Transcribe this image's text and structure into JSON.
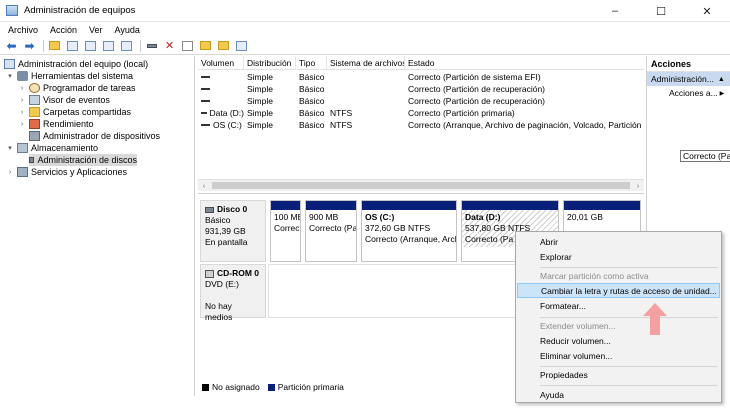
{
  "window": {
    "title": "Administración de equipos",
    "minimize_glyph": "–",
    "maximize_glyph": "☐",
    "close_glyph": "✕"
  },
  "menu": [
    "Archivo",
    "Acción",
    "Ver",
    "Ayuda"
  ],
  "toolbar": {
    "icons": [
      "back-arrow-icon",
      "forward-arrow-icon",
      "up-folder-icon",
      "show-tree-icon",
      "properties-icon",
      "help-icon",
      "connect-icon",
      "delete-icon",
      "check-icon",
      "folder-icon",
      "rescan-icon",
      "view-icon"
    ]
  },
  "tree": {
    "items": [
      {
        "label": "Administración del equipo (local)",
        "level": 0,
        "expanded": "",
        "icon": "computer-icon"
      },
      {
        "label": "Herramientas del sistema",
        "level": 1,
        "expanded": "▾",
        "icon": "tools-icon"
      },
      {
        "label": "Programador de tareas",
        "level": 2,
        "expanded": "›",
        "icon": "clock-icon"
      },
      {
        "label": "Visor de eventos",
        "level": 2,
        "expanded": "›",
        "icon": "event-log-icon"
      },
      {
        "label": "Carpetas compartidas",
        "level": 2,
        "expanded": "›",
        "icon": "shared-folder-icon"
      },
      {
        "label": "Rendimiento",
        "level": 2,
        "expanded": "›",
        "icon": "performance-icon"
      },
      {
        "label": "Administrador de dispositivos",
        "level": 2,
        "expanded": "",
        "icon": "device-manager-icon"
      },
      {
        "label": "Almacenamiento",
        "level": 1,
        "expanded": "▾",
        "icon": "storage-icon"
      },
      {
        "label": "Administración de discos",
        "level": 2,
        "expanded": "",
        "icon": "disk-icon",
        "selected": true
      },
      {
        "label": "Servicios y Aplicaciones",
        "level": 1,
        "expanded": "›",
        "icon": "services-icon"
      }
    ]
  },
  "volumes": {
    "columns": [
      "Volumen",
      "Distribución",
      "Tipo",
      "Sistema de archivos",
      "Estado"
    ],
    "rows": [
      {
        "volume": "",
        "layout": "Simple",
        "type": "Básico",
        "fs": "",
        "status": "Correcto (Partición de sistema EFI)"
      },
      {
        "volume": "",
        "layout": "Simple",
        "type": "Básico",
        "fs": "",
        "status": "Correcto (Partición de recuperación)"
      },
      {
        "volume": "",
        "layout": "Simple",
        "type": "Básico",
        "fs": "",
        "status": "Correcto (Partición de recuperación)"
      },
      {
        "volume": "Data (D:)",
        "layout": "Simple",
        "type": "Básico",
        "fs": "NTFS",
        "status": "Correcto (Partición primaria)"
      },
      {
        "volume": "OS (C:)",
        "layout": "Simple",
        "type": "Básico",
        "fs": "NTFS",
        "status": "Correcto (Arranque, Archivo de paginación, Volcado, Partición pr"
      }
    ],
    "scroll_left": "‹",
    "scroll_right": "›"
  },
  "disk0": {
    "name": "Disco 0",
    "type": "Básico",
    "size": "931,39 GB",
    "state": "En pantalla",
    "partitions": [
      {
        "title": "",
        "size": "100 ME",
        "status": "Correcto"
      },
      {
        "title": "",
        "size": "900 MB",
        "status": "Correcto (Pa"
      },
      {
        "title": "OS  (C:)",
        "size": "372,60 GB NTFS",
        "status": "Correcto (Arranque, Arch"
      },
      {
        "title": "Data  (D:)",
        "size": "537,80 GB NTFS",
        "status": "Correcto (Pa"
      },
      {
        "title": "",
        "size": "20,01 GB",
        "status": ""
      }
    ]
  },
  "cdrom0": {
    "name": "CD-ROM 0",
    "type": "DVD (E:)",
    "state": "No hay medios"
  },
  "legend": {
    "unallocated": "No asignado",
    "primary": "Partición primaria"
  },
  "actions": {
    "title": "Acciones",
    "section": "Administración...",
    "section_arrow": "▲",
    "more": "Acciones a...",
    "more_arrow": "▶"
  },
  "tooltip": "Correcto (Par",
  "context_menu": {
    "items": [
      {
        "label": "Abrir",
        "disabled": false
      },
      {
        "label": "Explorar",
        "disabled": false
      },
      {
        "label": "Marcar partición como activa",
        "disabled": true
      },
      {
        "label": "Cambiar la letra y rutas de acceso de unidad...",
        "disabled": false,
        "highlighted": true
      },
      {
        "label": "Formatear...",
        "disabled": false
      },
      {
        "label": "Extender volumen...",
        "disabled": true
      },
      {
        "label": "Reducir volumen...",
        "disabled": false
      },
      {
        "label": "Eliminar volumen...",
        "disabled": false
      },
      {
        "label": "Propiedades",
        "disabled": false
      },
      {
        "label": "Ayuda",
        "disabled": false
      }
    ]
  },
  "colors": {
    "primary_partition": "#0a1f7a",
    "highlight": "#cce4f7",
    "pointer_arrow": "#f4a0a0"
  }
}
